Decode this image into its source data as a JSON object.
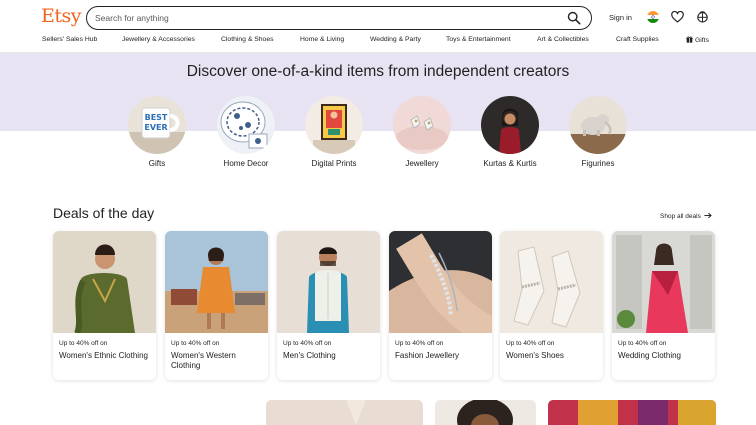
{
  "header": {
    "logo": "Etsy",
    "search_placeholder": "Search for anything",
    "signin_label": "Sign in",
    "icons": {
      "search": "search-icon",
      "flag": "india-flag-icon",
      "favorites": "heart-icon",
      "cart": "cart-icon"
    }
  },
  "nav": {
    "items": [
      "Sellers' Sales Hub",
      "Jewellery & Accessories",
      "Clothing & Shoes",
      "Home & Living",
      "Wedding & Party",
      "Toys & Entertainment",
      "Art & Collectibles",
      "Craft Supplies",
      "Gifts"
    ]
  },
  "hero": {
    "title": "Discover one-of-a-kind items from independent creators",
    "categories": [
      "Gifts",
      "Home Decor",
      "Digital Prints",
      "Jewellery",
      "Kurtas & Kurtis",
      "Figurines"
    ]
  },
  "deals": {
    "title": "Deals of the day",
    "shop_all": "Shop all deals",
    "cards": [
      {
        "discount": "Up to 40% off on",
        "name": "Women's Ethnic Clothing"
      },
      {
        "discount": "Up to 40% off on",
        "name": "Women's Western Clothing"
      },
      {
        "discount": "Up to 40% off on",
        "name": "Men's Clothing"
      },
      {
        "discount": "Up to 40% off on",
        "name": "Fashion Jewellery"
      },
      {
        "discount": "Up to 40% off on",
        "name": "Women's Shoes"
      },
      {
        "discount": "Up to 40% off on",
        "name": "Wedding Clothing"
      }
    ]
  },
  "colors": {
    "brand": "#f1641e",
    "hero_band": "#e8e3f3",
    "text": "#222222"
  }
}
